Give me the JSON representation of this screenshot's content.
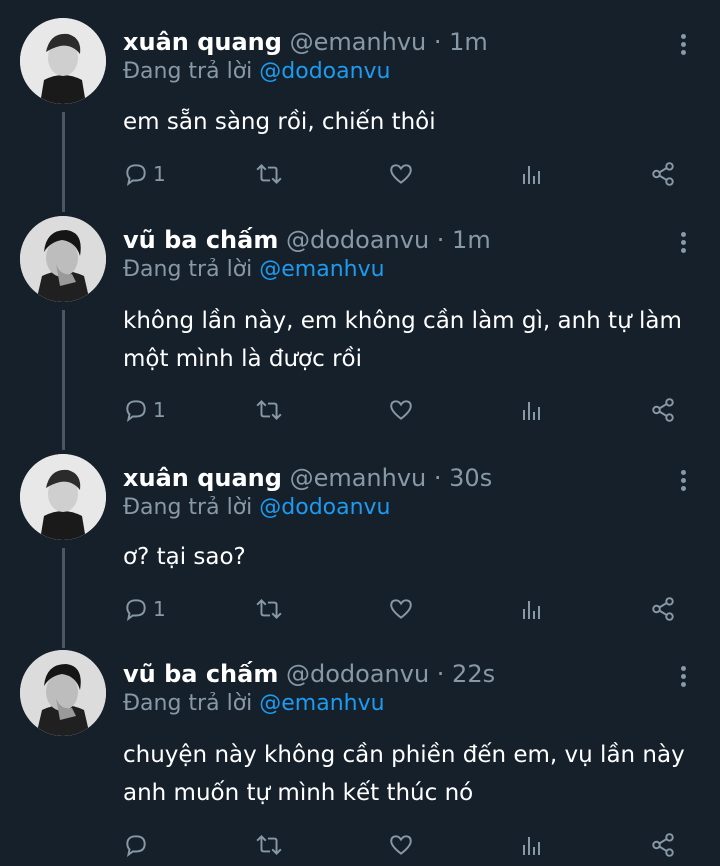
{
  "tweets": [
    {
      "name": "xuân quang",
      "handle": "@emanhvu",
      "time": "· 1m",
      "reply_prefix": "Đang trả lời ",
      "reply_to": "@dodoanvu",
      "text": "em sẵn sàng rồi, chiến thôi",
      "reply_count": "1"
    },
    {
      "name": "vũ ba chấm",
      "handle": "@dodoanvu",
      "time": "· 1m",
      "reply_prefix": "Đang trả lời ",
      "reply_to": "@emanhvu",
      "text": "không lần này, em không cần làm gì, anh tự làm một mình là được rồi",
      "reply_count": "1"
    },
    {
      "name": "xuân quang",
      "handle": "@emanhvu",
      "time": "· 30s",
      "reply_prefix": "Đang trả lời ",
      "reply_to": "@dodoanvu",
      "text": "ơ? tại sao?",
      "reply_count": "1"
    },
    {
      "name": "vũ ba chấm",
      "handle": "@dodoanvu",
      "time": "· 22s",
      "reply_prefix": "Đang trả lời ",
      "reply_to": "@emanhvu",
      "text": "chuyện này không cần phiền đến em, vụ lần này anh muốn tự mình kết thúc nó",
      "reply_count": ""
    }
  ],
  "icons": {
    "reply": "reply-icon",
    "retweet": "retweet-icon",
    "like": "heart-icon",
    "analytics": "analytics-icon",
    "share": "share-icon",
    "more": "more-icon"
  },
  "colors": {
    "background": "#15202b",
    "secondary_text": "#8899a6",
    "mention": "#1d9bf0"
  }
}
